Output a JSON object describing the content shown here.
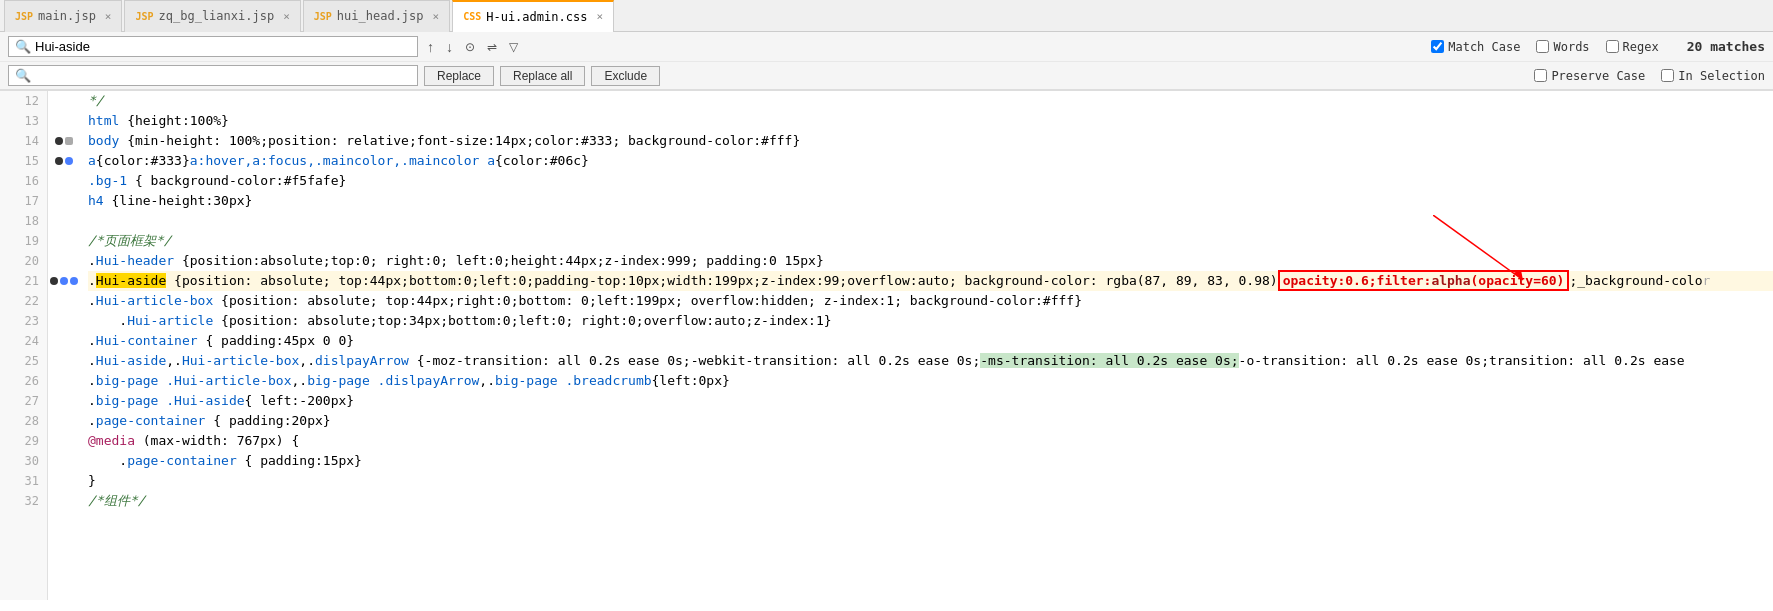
{
  "tabs": [
    {
      "id": "main",
      "label": "main.jsp",
      "icon": "JSP",
      "active": false,
      "color": "#e8a020"
    },
    {
      "id": "zq",
      "label": "zq_bg_lianxi.jsp",
      "icon": "JSP",
      "active": false,
      "color": "#e8a020"
    },
    {
      "id": "hui",
      "label": "hui_head.jsp",
      "icon": "JSP",
      "active": false,
      "color": "#e8a020"
    },
    {
      "id": "admin",
      "label": "H-ui.admin.css",
      "icon": "CSS",
      "active": true,
      "color": "#f90"
    }
  ],
  "search": {
    "value": "Hui-aside",
    "placeholder": "",
    "replace_value": "",
    "replace_placeholder": ""
  },
  "toolbar": {
    "match_case_label": "Match Case",
    "words_label": "Words",
    "regex_label": "Regex",
    "match_count": "20 matches",
    "preserve_case_label": "Preserve Case",
    "in_selection_label": "In Selection",
    "replace_label": "Replace",
    "replace_all_label": "Replace all",
    "exclude_label": "Exclude"
  },
  "lines": [
    {
      "num": 12,
      "content": "*/",
      "type": "comment",
      "gutter": []
    },
    {
      "num": 13,
      "content": "html {height:100%}",
      "type": "code",
      "gutter": []
    },
    {
      "num": 14,
      "content": "body {min-height: 100%;position: relative;font-size:14px;color:#333; background-color:#fff}",
      "type": "code",
      "gutter": [
        "black",
        "blue"
      ]
    },
    {
      "num": 15,
      "content": "a{color:#333}a:hover,a:focus,.maincolor,.maincolor a{color:#06c}",
      "type": "code",
      "gutter": [
        "black",
        "blue"
      ]
    },
    {
      "num": 16,
      "content": ".bg-1 { background-color:#f5fafe}",
      "type": "code",
      "gutter": []
    },
    {
      "num": 17,
      "content": "h4 {line-height:30px}",
      "type": "code",
      "gutter": []
    },
    {
      "num": 18,
      "content": "",
      "type": "empty",
      "gutter": []
    },
    {
      "num": 19,
      "content": "/*页面框架*/",
      "type": "comment",
      "gutter": []
    },
    {
      "num": 20,
      "content": ".Hui-header {position:absolute;top:0; right:0; left:0;height:44px;z-index:999; padding:0 15px}",
      "type": "code",
      "gutter": []
    },
    {
      "num": 21,
      "content": ".Hui-aside {position: absolute; top:44px;bottom:0;left:0;padding-top:10px;width:199px;z-index:99;overflow:auto; background-color: rgba(87, 89, 83, 0.98)",
      "type": "code",
      "gutter": [
        "black",
        "blue",
        "blue"
      ],
      "highlight_aside": true,
      "append": "opacity:0.6;filter:alpha(opacity=60);_background-colo"
    },
    {
      "num": 22,
      "content": ".Hui-article-box {position: absolute; top:44px;right:0;bottom: 0;left:199px; overflow:hidden; z-index:1; background-color:#fff}",
      "type": "code",
      "gutter": []
    },
    {
      "num": 23,
      "content": "    .Hui-article {position: absolute;top:34px;bottom:0;left:0; right:0;overflow:auto;z-index:1}",
      "type": "code",
      "gutter": []
    },
    {
      "num": 24,
      "content": ".Hui-container { padding:45px 0 0}",
      "type": "code",
      "gutter": []
    },
    {
      "num": 25,
      "content": ".Hui-aside,.Hui-article-box,.dislpayArrow {-moz-transition: all 0.2s ease 0s;-webkit-transition: all 0.2s ease 0s;",
      "type": "code",
      "gutter": [],
      "highlight_ms": true
    },
    {
      "num": 26,
      "content": ".big-page .Hui-article-box,.big-page .dislpayArrow,.big-page .breadcrumb{left:0px}",
      "type": "code",
      "gutter": []
    },
    {
      "num": 27,
      "content": ".big-page .Hui-aside{ left:-200px}",
      "type": "code",
      "gutter": []
    },
    {
      "num": 28,
      "content": ".page-container { padding:20px}",
      "type": "code",
      "gutter": []
    },
    {
      "num": 29,
      "content": "@media (max-width: 767px) {",
      "type": "code",
      "gutter": []
    },
    {
      "num": 30,
      "content": "    .page-container { padding:15px}",
      "type": "code",
      "gutter": []
    },
    {
      "num": 31,
      "content": "}",
      "type": "code",
      "gutter": []
    },
    {
      "num": 32,
      "content": "/*组件*/",
      "type": "comment",
      "gutter": []
    }
  ]
}
